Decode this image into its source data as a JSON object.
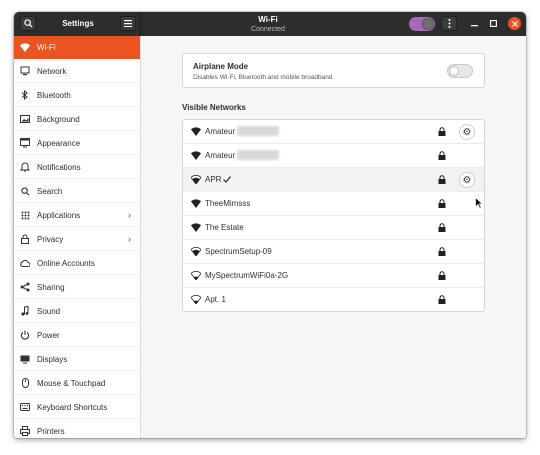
{
  "headerbar": {
    "app_title": "Settings",
    "panel_title": "Wi-Fi",
    "panel_status": "Connected",
    "wifi_enabled": true,
    "accent_color": "#e95420",
    "toggle_color": "#a868b9"
  },
  "sidebar": {
    "items": [
      {
        "label": "Wi-Fi",
        "icon": "wifi-icon",
        "active": true
      },
      {
        "label": "Network",
        "icon": "network-icon"
      },
      {
        "label": "Bluetooth",
        "icon": "bluetooth-icon"
      },
      {
        "label": "Background",
        "icon": "background-icon"
      },
      {
        "label": "Appearance",
        "icon": "appearance-icon"
      },
      {
        "label": "Notifications",
        "icon": "notifications-icon"
      },
      {
        "label": "Search",
        "icon": "search-icon"
      },
      {
        "label": "Applications",
        "icon": "applications-icon",
        "has_submenu": true
      },
      {
        "label": "Privacy",
        "icon": "privacy-icon",
        "has_submenu": true
      },
      {
        "label": "Online Accounts",
        "icon": "online-accounts-icon"
      },
      {
        "label": "Sharing",
        "icon": "sharing-icon"
      },
      {
        "label": "Sound",
        "icon": "sound-icon"
      },
      {
        "label": "Power",
        "icon": "power-icon"
      },
      {
        "label": "Displays",
        "icon": "displays-icon"
      },
      {
        "label": "Mouse & Touchpad",
        "icon": "mouse-icon"
      },
      {
        "label": "Keyboard Shortcuts",
        "icon": "keyboard-icon"
      },
      {
        "label": "Printers",
        "icon": "printer-icon"
      }
    ]
  },
  "airplane": {
    "title": "Airplane Mode",
    "subtitle": "Disables Wi-Fi, Bluetooth and mobile broadband",
    "enabled": false
  },
  "networks": {
    "section_title": "Visible Networks",
    "items": [
      {
        "name": "Amateur",
        "redacted": true,
        "secured": true,
        "has_settings": true,
        "signal": "full"
      },
      {
        "name": "Amateur",
        "redacted": true,
        "secured": true,
        "signal": "full"
      },
      {
        "name": "APR",
        "connected": true,
        "secured": true,
        "has_settings": true,
        "signal": "good"
      },
      {
        "name": "TheeMimsss",
        "secured": true,
        "signal": "full"
      },
      {
        "name": "The Estate",
        "secured": true,
        "signal": "full"
      },
      {
        "name": "SpectrumSetup-09",
        "secured": true,
        "signal": "good"
      },
      {
        "name": "MySpectrumWiFi0a-2G",
        "secured": true,
        "signal": "low"
      },
      {
        "name": "Apt. 1",
        "secured": true,
        "signal": "low"
      }
    ]
  }
}
